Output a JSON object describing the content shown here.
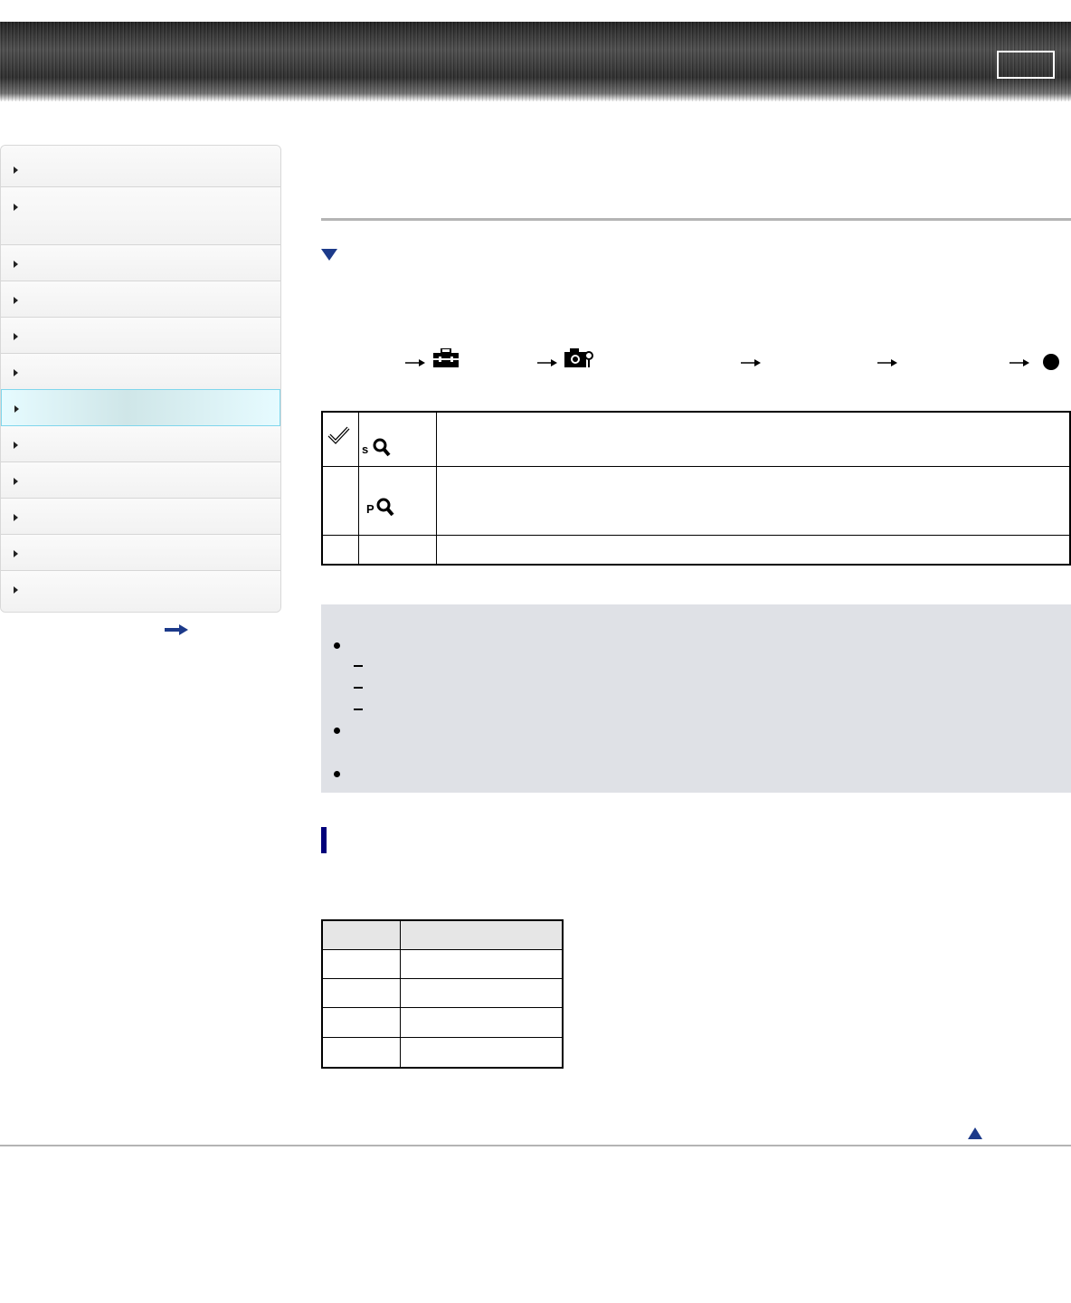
{
  "header": {
    "page_box_label": ""
  },
  "sidebar": {
    "items": [
      {
        "label": ""
      },
      {
        "label": ""
      },
      {
        "label": ""
      },
      {
        "label": ""
      },
      {
        "label": ""
      },
      {
        "label": ""
      },
      {
        "label": ""
      },
      {
        "label": ""
      },
      {
        "label": ""
      },
      {
        "label": ""
      },
      {
        "label": ""
      },
      {
        "label": ""
      }
    ],
    "active_index": 6,
    "more_icon": "right-arrow-icon"
  },
  "main": {
    "title": "",
    "section_toggle_icon": "triangle-down-icon",
    "menu_path_icons": [
      "right-arrow-icon",
      "toolbox-icon",
      "right-arrow-icon",
      "camera-settings-icon",
      "right-arrow-icon",
      "right-arrow-icon",
      "right-arrow-icon",
      "filled-circle-icon"
    ],
    "options": [
      {
        "selected": true,
        "icon": "s-zoom-icon",
        "icon_letter": "s",
        "description": ""
      },
      {
        "selected": false,
        "icon": "p-zoom-icon",
        "icon_letter": "P",
        "description": ""
      },
      {
        "selected": false,
        "icon": "",
        "icon_letter": "",
        "description": ""
      }
    ],
    "notes": {
      "bullets": 3,
      "sub_items": 3
    },
    "small_table": {
      "headers": [
        "",
        ""
      ],
      "rows": [
        [
          "",
          ""
        ],
        [
          "",
          ""
        ],
        [
          "",
          ""
        ],
        [
          "",
          ""
        ]
      ]
    },
    "back_to_top_icon": "triangle-up-icon"
  },
  "colors": {
    "accent": "#1c3a8a",
    "section_marker": "#00007a",
    "notes_bg": "#dfe1e6",
    "active_nav": "#e6fbff"
  }
}
